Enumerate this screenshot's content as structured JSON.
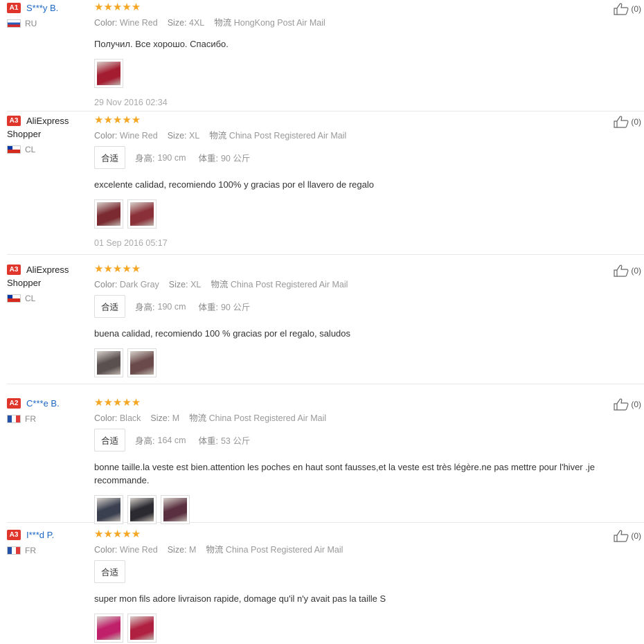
{
  "reviews": [
    {
      "level": "A1",
      "name": "S***y B.",
      "name_style": "link",
      "country": "RU",
      "flag": "ru",
      "stars": "★★★★★",
      "color_label": "Color:",
      "color": "Wine Red",
      "size_label": "Size:",
      "size": "4XL",
      "ship_label": "物流",
      "ship": "HongKong Post Air Mail",
      "fit": null,
      "text": "Получил. Все хорошо. Спасибо.",
      "photos": [
        "#a31c30"
      ],
      "date": "29 Nov 2016 02:34",
      "helpful": "(0)"
    },
    {
      "level": "A3",
      "name": "AliExpress Shopper",
      "name_style": "plain",
      "country": "CL",
      "flag": "cl",
      "stars": "★★★★★",
      "color_label": "Color:",
      "color": "Wine Red",
      "size_label": "Size:",
      "size": "XL",
      "ship_label": "物流",
      "ship": "China Post Registered Air Mail",
      "fit": {
        "badge": "合适",
        "height_label": "身高:",
        "height": "190 cm",
        "weight_label": "体重:",
        "weight": "90 公斤"
      },
      "text": "excelente calidad, recomiendo 100% y gracias por el llavero de regalo",
      "photos": [
        "#7a2a30",
        "#8a3038"
      ],
      "date": "01 Sep 2016 05:17",
      "helpful": "(0)"
    },
    {
      "level": "A3",
      "name": "AliExpress Shopper",
      "name_style": "plain",
      "country": "CL",
      "flag": "cl",
      "stars": "★★★★★",
      "color_label": "Color:",
      "color": "Dark Gray",
      "size_label": "Size:",
      "size": "XL",
      "ship_label": "物流",
      "ship": "China Post Registered Air Mail",
      "fit": {
        "badge": "合适",
        "height_label": "身高:",
        "height": "190 cm",
        "weight_label": "体重:",
        "weight": "90 公斤"
      },
      "text": "buena calidad, recomiendo 100 % gracias por el regalo, saludos",
      "photos": [
        "#5a5050",
        "#6a4a4a"
      ],
      "date": null,
      "helpful": "(0)"
    },
    {
      "level": "A2",
      "name": "C***e B.",
      "name_style": "link",
      "country": "FR",
      "flag": "fr",
      "stars": "★★★★★",
      "color_label": "Color:",
      "color": "Black",
      "size_label": "Size:",
      "size": "M",
      "ship_label": "物流",
      "ship": "China Post Registered Air Mail",
      "fit": {
        "badge": "合适",
        "height_label": "身高:",
        "height": "164 cm",
        "weight_label": "体重:",
        "weight": "53 公斤"
      },
      "text": "bonne taille.la veste est bien.attention les poches en haut sont fausses,et la veste est très légère.ne pas mettre pour l'hiver .je recommande.",
      "photos": [
        "#3a4050",
        "#2a2a30",
        "#5a3040"
      ],
      "date": null,
      "helpful": "(0)"
    },
    {
      "level": "A3",
      "name": "I***d P.",
      "name_style": "link",
      "country": "FR",
      "flag": "fr",
      "stars": "★★★★★",
      "color_label": "Color:",
      "color": "Wine Red",
      "size_label": "Size:",
      "size": "M",
      "ship_label": "物流",
      "ship": "China Post Registered Air Mail",
      "fit": {
        "badge": "合适"
      },
      "text": "super mon fils adore livraison rapide, domage qu'il n'y avait pas la taille S",
      "photos": [
        "#c0206a",
        "#b02040"
      ],
      "date": null,
      "helpful": "(0)"
    }
  ]
}
